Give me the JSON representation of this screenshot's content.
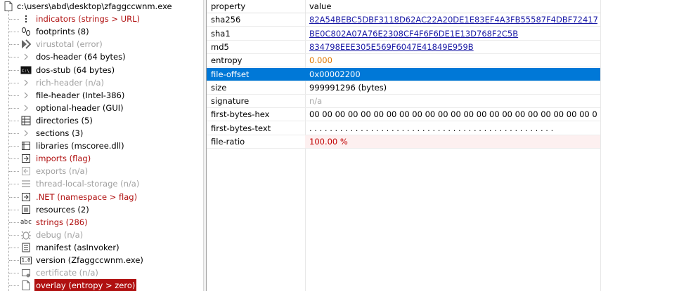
{
  "tree": {
    "root": {
      "label": "c:\\users\\abd\\desktop\\zfaggccwnm.exe"
    },
    "items": [
      {
        "label": "indicators (strings > URL)",
        "style": "red",
        "icon": "indicators-icon"
      },
      {
        "label": "footprints (8)",
        "style": "normal",
        "icon": "footprints-icon"
      },
      {
        "label": "virustotal (error)",
        "style": "gray",
        "icon": "virustotal-icon"
      },
      {
        "label": "dos-header (64 bytes)",
        "style": "normal",
        "icon": "expand-arrow-icon"
      },
      {
        "label": "dos-stub (64 bytes)",
        "style": "normal",
        "icon": "console-icon"
      },
      {
        "label": "rich-header (n/a)",
        "style": "gray",
        "icon": "expand-arrow-icon"
      },
      {
        "label": "file-header (Intel-386)",
        "style": "normal",
        "icon": "expand-arrow-icon"
      },
      {
        "label": "optional-header (GUI)",
        "style": "normal",
        "icon": "expand-arrow-icon"
      },
      {
        "label": "directories (5)",
        "style": "normal",
        "icon": "directories-icon"
      },
      {
        "label": "sections (3)",
        "style": "normal",
        "icon": "expand-arrow-icon"
      },
      {
        "label": "libraries (mscoree.dll)",
        "style": "normal",
        "icon": "libraries-icon"
      },
      {
        "label": "imports (flag)",
        "style": "red",
        "icon": "imports-icon"
      },
      {
        "label": "exports (n/a)",
        "style": "gray",
        "icon": "exports-icon"
      },
      {
        "label": "thread-local-storage (n/a)",
        "style": "gray",
        "icon": "tls-icon"
      },
      {
        "label": ".NET (namespace > flag)",
        "style": "red",
        "icon": "dotnet-icon"
      },
      {
        "label": "resources (2)",
        "style": "normal",
        "icon": "resources-icon"
      },
      {
        "label": "strings (286)",
        "style": "red",
        "icon": "strings-icon"
      },
      {
        "label": "debug (n/a)",
        "style": "gray",
        "icon": "debug-icon"
      },
      {
        "label": "manifest (asInvoker)",
        "style": "normal",
        "icon": "manifest-icon"
      },
      {
        "label": "version (Zfaggccwnm.exe)",
        "style": "normal",
        "icon": "version-icon"
      },
      {
        "label": "certificate (n/a)",
        "style": "gray",
        "icon": "certificate-icon"
      },
      {
        "label": "overlay (entropy > zero)",
        "style": "selected-red",
        "icon": "overlay-icon"
      }
    ],
    "icon_glyphs": {
      "strings": "abc",
      "version": "1.0"
    }
  },
  "grid": {
    "headers": {
      "property": "property",
      "value": "value"
    },
    "rows": [
      {
        "property": "sha256",
        "value": "82A54BEBC5DBF3118D62AC22A20DE1E83EF4A3FB55587F4DBF72417CE7496D...",
        "kind": "link"
      },
      {
        "property": "sha1",
        "value": "BE0C802A07A76E2308CF4F6F6DE1E13D768F2C5B",
        "kind": "link"
      },
      {
        "property": "md5",
        "value": "834798EEE305E569F6047E41849E959B",
        "kind": "link"
      },
      {
        "property": "entropy",
        "value": "0.000",
        "kind": "orange"
      },
      {
        "property": "file-offset",
        "value": "0x00002200",
        "kind": "selected"
      },
      {
        "property": "size",
        "value": "999991296 (bytes)",
        "kind": "normal"
      },
      {
        "property": "signature",
        "value": "n/a",
        "kind": "na"
      },
      {
        "property": "first-bytes-hex",
        "value": "00 00 00 00 00 00 00 00 00 00 00 00 00 00 00 00 00 00 00 00 00 00 00 00 00 00 00 00 00 00 00 00 00 ...",
        "kind": "normal"
      },
      {
        "property": "first-bytes-text",
        "value": ". . . . . . . . . . . . . . . . . . . . . . . . . . . . . . . . . . . . . . . . . . . . . . . .",
        "kind": "normal"
      },
      {
        "property": "file-ratio",
        "value": "100.00 %",
        "kind": "pink"
      }
    ]
  },
  "colors": {
    "flag_red": "#b01010",
    "selection_blue": "#0078d7",
    "link": "#1a1aa6",
    "entropy_orange": "#e07800"
  }
}
